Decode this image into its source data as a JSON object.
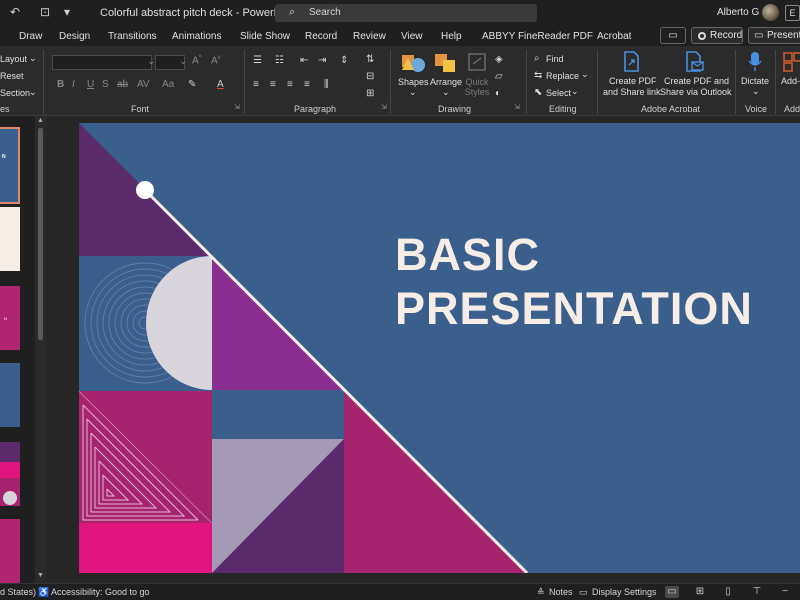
{
  "window": {
    "doc_title": "Colorful abstract pitch deck  -  PowerP...",
    "search_placeholder": "Search",
    "user_name": "Alberto G",
    "badge": "E"
  },
  "tabs": [
    "Draw",
    "Design",
    "Transitions",
    "Animations",
    "Slide Show",
    "Record",
    "Review",
    "View",
    "Help",
    "ABBYY FineReader PDF",
    "Acrobat"
  ],
  "tab_actions": {
    "record_label": "Record",
    "present_label": "Present"
  },
  "ribbon": {
    "slides_group": {
      "layout_label": "Layout",
      "reset_label": "Reset",
      "section_label": "Section",
      "group_label": "es"
    },
    "font_group": {
      "group_label": "Font"
    },
    "paragraph_group": {
      "group_label": "Paragraph"
    },
    "drawing_group": {
      "shapes_label": "Shapes",
      "arrange_label": "Arrange",
      "quick_styles_label": "Quick Styles",
      "group_label": "Drawing"
    },
    "editing_group": {
      "find_label": "Find",
      "replace_label": "Replace",
      "select_label": "Select",
      "group_label": "Editing"
    },
    "acrobat_group": {
      "create_pdf_label_1": "Create PDF",
      "create_pdf_label_2": "and Share link",
      "share_outlook_label_1": "Create PDF and",
      "share_outlook_label_2": "Share via Outlook",
      "group_label": "Adobe Acrobat"
    },
    "voice_group": {
      "dictate_label": "Dictate",
      "group_label": "Voice"
    },
    "addins_group": {
      "addins_label": "Add-",
      "group_label": "Add-"
    }
  },
  "slide": {
    "title": "BASIC\nPRESENTATION"
  },
  "statusbar": {
    "language": "d States)",
    "accessibility": "Accessibility: Good to go",
    "notes_label": "Notes",
    "display_settings_label": "Display Settings"
  },
  "colors": {
    "slide_blue": "#3a5f8c",
    "purple_dark": "#5a2a6a",
    "magenta": "#a6236e",
    "hot_pink": "#e0157f",
    "violet": "#8a2e8f",
    "lavender": "#a49ab5",
    "cream": "#f5ede6"
  },
  "icons": {
    "autosave": "disk-icon",
    "undo": "undo-icon",
    "search": "search-icon"
  }
}
